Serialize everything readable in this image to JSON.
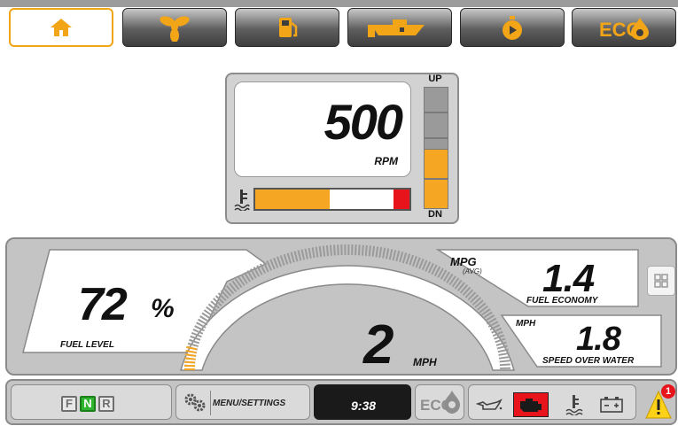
{
  "tabs": [
    {
      "name": "home",
      "icon": "home-icon",
      "active": true
    },
    {
      "name": "propeller",
      "icon": "propeller-icon",
      "active": false
    },
    {
      "name": "fuel",
      "icon": "fuel-pump-icon",
      "active": false
    },
    {
      "name": "boat",
      "icon": "boat-icon",
      "active": false
    },
    {
      "name": "trip",
      "icon": "trip-timer-icon",
      "active": false
    },
    {
      "name": "eco",
      "icon": "eco-icon",
      "label": "ECO",
      "active": false
    }
  ],
  "engine": {
    "rpm": "500",
    "rpm_unit": "RPM",
    "trim_up_label": "UP",
    "trim_down_label": "DN",
    "trim_level_fraction": 0.5,
    "temperature_fraction": 0.48
  },
  "fuel": {
    "value": "72",
    "unit": "%",
    "label": "FUEL LEVEL"
  },
  "economy": {
    "label": "MPG",
    "sub_label": "(AVG)",
    "value": "1.4",
    "caption": "FUEL ECONOMY"
  },
  "speed_over_water": {
    "unit": "MPH",
    "value": "1.8",
    "caption": "SPEED OVER WATER"
  },
  "speedometer": {
    "value": "2",
    "unit": "MPH",
    "fill_fraction": 0.03
  },
  "bottom": {
    "gears": [
      "F",
      "N",
      "R"
    ],
    "selected_gear": "N",
    "menu_label": "MENU/SETTINGS",
    "clock": "9:38",
    "eco_label": "ECO",
    "alert_count": "1"
  },
  "colors": {
    "accent_orange": "#f5a623",
    "alarm_red": "#e8141b",
    "neutral_green": "#2fb52f"
  }
}
